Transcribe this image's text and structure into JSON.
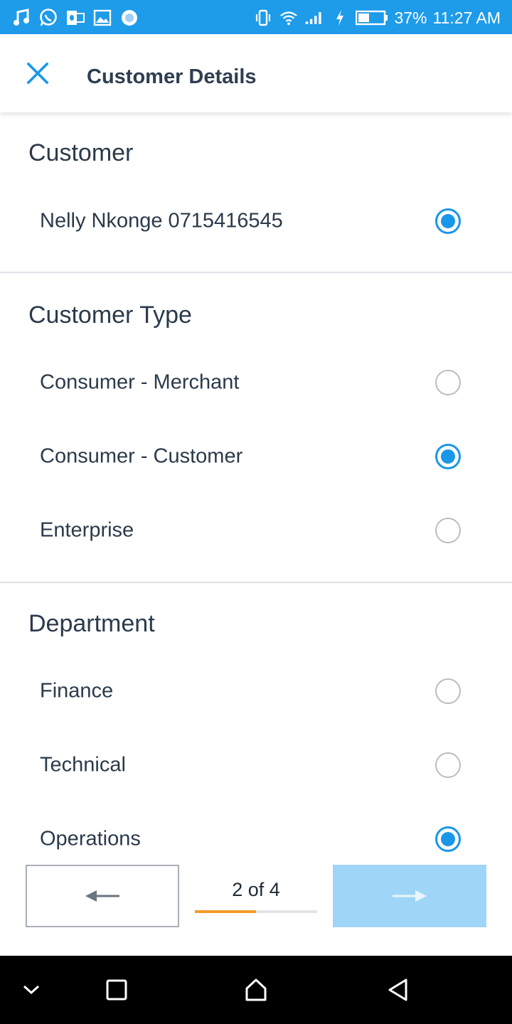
{
  "status_bar": {
    "battery": "37%",
    "time": "11:27 AM",
    "left_icons": [
      "music-note-icon",
      "whatsapp-icon",
      "outlook-icon",
      "image-icon",
      "circle-app-icon"
    ],
    "right_icons": [
      "vibrate-icon",
      "wifi-icon",
      "signal-icon",
      "charging-icon",
      "battery-icon"
    ]
  },
  "app_bar": {
    "title": "Customer Details",
    "close_icon": "close-icon",
    "accent": "#1997e8"
  },
  "sections": [
    {
      "title": "Customer",
      "options": [
        {
          "label": "Nelly Nkonge 0715416545",
          "selected": true
        }
      ]
    },
    {
      "title": "Customer Type",
      "options": [
        {
          "label": "Consumer - Merchant",
          "selected": false
        },
        {
          "label": "Consumer - Customer",
          "selected": true
        },
        {
          "label": "Enterprise",
          "selected": false
        }
      ]
    },
    {
      "title": "Department",
      "options": [
        {
          "label": "Finance",
          "selected": false
        },
        {
          "label": "Technical",
          "selected": false
        },
        {
          "label": "Operations",
          "selected": true
        }
      ]
    }
  ],
  "footer": {
    "pager_text": "2 of 4",
    "progress": 0.5,
    "progress_color": "#f39a2b",
    "prev_icon": "arrow-left-icon",
    "next_icon": "arrow-right-icon",
    "next_button_color": "#9fd6f7"
  },
  "system_nav": {
    "icons": [
      "chevron-down-icon",
      "recents-square-icon",
      "home-icon",
      "back-triangle-icon"
    ]
  }
}
